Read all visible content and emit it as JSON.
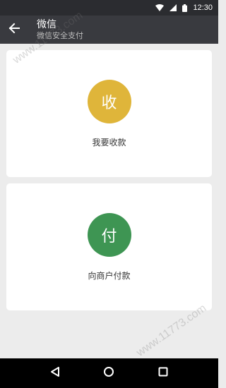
{
  "status_bar": {
    "time": "12:30",
    "icons": [
      "wifi-icon",
      "signal-icon",
      "battery-icon"
    ]
  },
  "app_bar": {
    "title": "微信",
    "subtitle": "微信安全支付",
    "back_icon": "arrow-left-icon"
  },
  "cards": {
    "receive": {
      "glyph": "收",
      "label": "我要收款",
      "color": "#dfb53a"
    },
    "pay": {
      "glyph": "付",
      "label": "向商户付款",
      "color": "#3e9553"
    }
  },
  "watermark": {
    "top": "www.11773.com",
    "bottom": "www.11773.com"
  },
  "nav_bar": {
    "icons": [
      "back-triangle-icon",
      "home-circle-icon",
      "recents-square-icon"
    ]
  }
}
